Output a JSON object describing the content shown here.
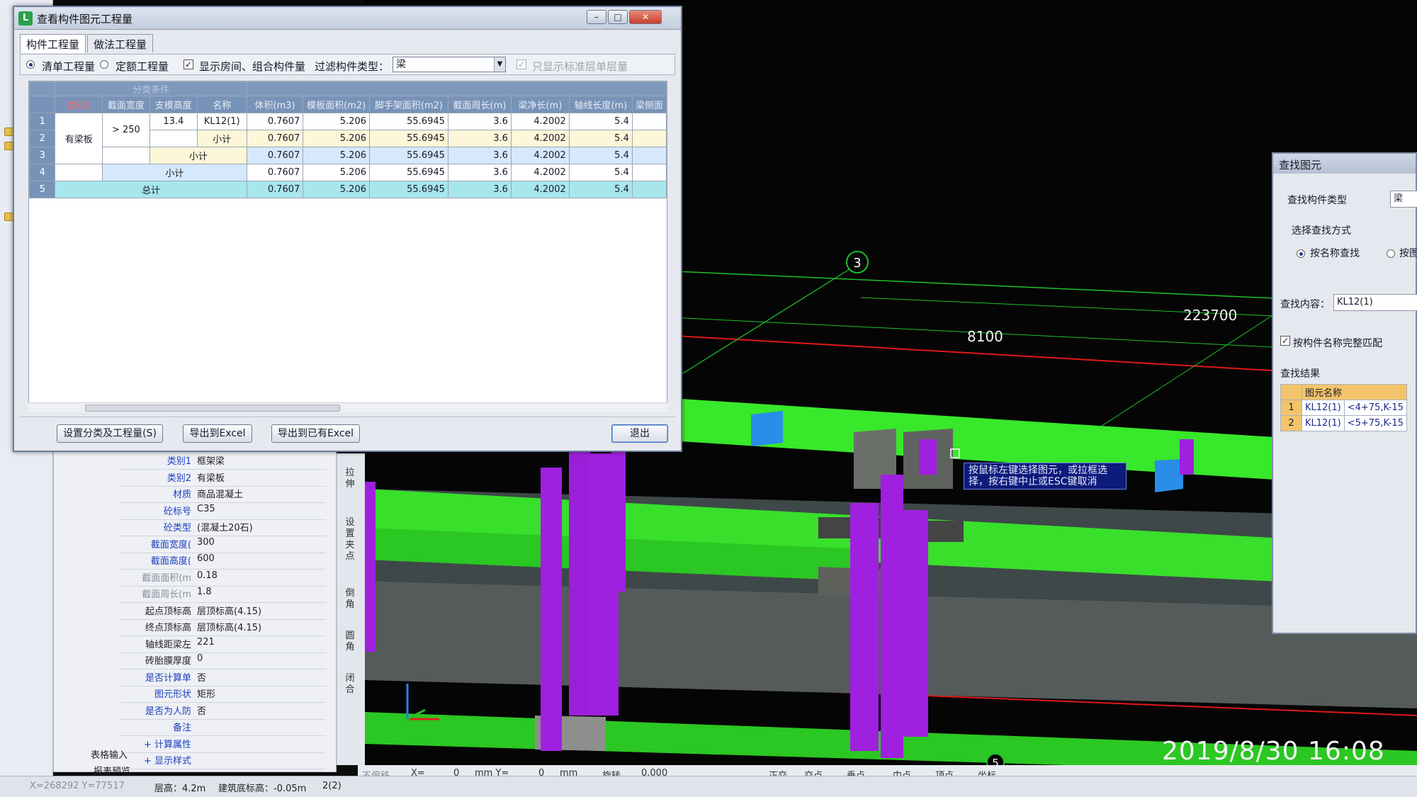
{
  "dialog": {
    "title": "查看构件图元工程量",
    "tabs": [
      "构件工程量",
      "做法工程量"
    ],
    "options": {
      "radio_list": "清单工程量",
      "radio_quota": "定额工程量",
      "show_rooms_label": "显示房间、组合构件量",
      "filter_label": "过滤构件类型：",
      "filter_value": "梁",
      "std_floor_label": "只显示标准层单层量"
    },
    "grid": {
      "group_header": "分类条件",
      "columns": [
        "类别2",
        "截面宽度",
        "支模高度",
        "名称",
        "体积(m3)",
        "模板面积(m2)",
        "脚手架面积(m2)",
        "截面周长(m)",
        "梁净长(m)",
        "轴线长度(m)",
        "梁侧面"
      ],
      "rows": [
        {
          "n": "1",
          "cat2": "有梁板",
          "width": "> 250",
          "height": "13.4",
          "name": "KL12(1)",
          "vol": "0.7607",
          "form": "5.206",
          "scaf": "55.6945",
          "peri": "3.6",
          "net": "4.2002",
          "axis": "5.4"
        },
        {
          "n": "2",
          "name": "小计",
          "vol": "0.7607",
          "form": "5.206",
          "scaf": "55.6945",
          "peri": "3.6",
          "net": "4.2002",
          "axis": "5.4"
        },
        {
          "n": "3",
          "name": "小计",
          "vol": "0.7607",
          "form": "5.206",
          "scaf": "55.6945",
          "peri": "3.6",
          "net": "4.2002",
          "axis": "5.4"
        },
        {
          "n": "4",
          "name": "小计",
          "vol": "0.7607",
          "form": "5.206",
          "scaf": "55.6945",
          "peri": "3.6",
          "net": "4.2002",
          "axis": "5.4"
        },
        {
          "n": "5",
          "name": "总计",
          "vol": "0.7607",
          "form": "5.206",
          "scaf": "55.6945",
          "peri": "3.6",
          "net": "4.2002",
          "axis": "5.4"
        }
      ]
    },
    "buttons": {
      "set_category": "设置分类及工程量(S)",
      "export_excel": "导出到Excel",
      "export_existing": "导出到已有Excel",
      "exit": "退出"
    }
  },
  "properties": [
    {
      "k": "类别1",
      "v": "框架梁"
    },
    {
      "k": "类别2",
      "v": "有梁板"
    },
    {
      "k": "材质",
      "v": "商品混凝土"
    },
    {
      "k": "砼标号",
      "v": "C35"
    },
    {
      "k": "砼类型",
      "v": "(混凝土20石)"
    },
    {
      "k": "截面宽度(",
      "v": "300"
    },
    {
      "k": "截面高度(",
      "v": "600"
    },
    {
      "k": "截面面积(m",
      "v": "0.18"
    },
    {
      "k": "截面周长(m",
      "v": "1.8"
    },
    {
      "k": "起点顶标高",
      "v": "层顶标高(4.15)"
    },
    {
      "k": "终点顶标高",
      "v": "层顶标高(4.15)"
    },
    {
      "k": "轴线距梁左",
      "v": "221"
    },
    {
      "k": "砖胎膜厚度",
      "v": "0"
    },
    {
      "k": "是否计算单",
      "v": "否"
    },
    {
      "k": "图元形状",
      "v": "矩形"
    },
    {
      "k": "是否为人防",
      "v": "否"
    },
    {
      "k": "备注",
      "v": ""
    },
    {
      "k": "+ 计算属性",
      "v": ""
    },
    {
      "k": "+ 显示样式",
      "v": ""
    }
  ],
  "left_nav": {
    "table_input": "表格输入",
    "report_preview": "报表预览"
  },
  "tools": [
    "拉伸",
    "设置夹点",
    "倒角",
    "圆角",
    "闭合"
  ],
  "viewport": {
    "axis_label_3": "3",
    "axis_label_5": "5",
    "dim_8100": "8100",
    "dim_223700": "223700",
    "hint": "按鼠标左键选择图元，或拉框选择，按右键中止或ESC键取消",
    "colors": {
      "beam": "#38e82a",
      "column": "#a020e0",
      "axis_red": "#e01818",
      "axis_green": "#1fbf2a"
    }
  },
  "find_dialog": {
    "title": "查找图元",
    "type_label": "查找构件类型",
    "type_value": "梁",
    "method_label": "选择查找方式",
    "by_name": "按名称查找",
    "by_other": "按图",
    "content_label": "查找内容：",
    "content_value": "KL12(1)",
    "exact_label": "按构件名称完整匹配",
    "results_label": "查找结果",
    "col_name": "图元名称",
    "results": [
      {
        "n": "1",
        "name": "KL12(1)",
        "loc": "<4+75,K-15"
      },
      {
        "n": "2",
        "name": "KL12(1)",
        "loc": "<5+75,K-15"
      }
    ]
  },
  "coord_bar": {
    "no_offset": "不偏移",
    "x_label": "X=",
    "x_val": "0",
    "mm1": "mm Y=",
    "y_val": "0",
    "mm2": "mm",
    "rotate": "旋转",
    "rot_val": "0.000",
    "ortho": "正交",
    "intersect": "交点",
    "perp": "垂点",
    "mid": "中点",
    "vertex": "顶点",
    "coord": "坐标"
  },
  "status": {
    "xy": "X=268292 Y=77517",
    "floor_h": "层高：4.2m",
    "base_elev": "建筑底标高：-0.05m",
    "sel": "2(2)"
  },
  "timestamp": "2019/8/30  16:08"
}
